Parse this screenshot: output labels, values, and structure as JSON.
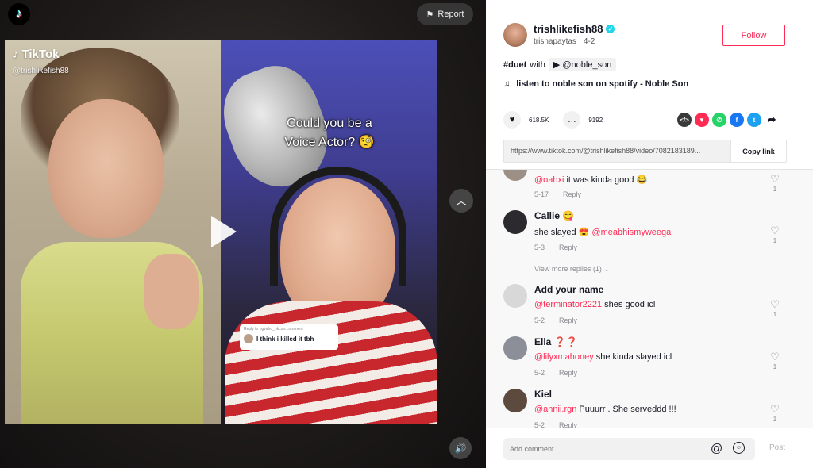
{
  "video": {
    "report_label": "Report",
    "watermark_brand": "TikTok",
    "watermark_user": "@trishlikefish88",
    "caption": "Could you be a Voice Actor? 🧐",
    "reply_title": "Reply to ogvaho_nkcs's comment",
    "reply_text": "I think i killed it tbh",
    "icons": [
      "tiktok-logo-icon",
      "flag-icon",
      "play-icon",
      "chevron-up-icon",
      "volume-icon"
    ]
  },
  "author": {
    "username": "trishlikefish88",
    "nickname": "trishapaytas",
    "date": "4-2",
    "follow_label": "Follow"
  },
  "description": {
    "hashtag": "#duet",
    "with_text": "with",
    "mention": "@noble_son",
    "music": "listen to noble son on spotify - Noble Son"
  },
  "stats": {
    "likes": "618.5K",
    "comments": "9192"
  },
  "share": {
    "url": "https://www.tiktok.com/@trishlikefish88/video/7082183189...",
    "copy_label": "Copy link",
    "icons": [
      "embed-icon",
      "send-icon",
      "whatsapp-icon",
      "facebook-icon",
      "twitter-icon",
      "forward-icon"
    ],
    "colors": {
      "embed": "#3a3a3a",
      "send": "#fe2c55",
      "whatsapp": "#25d366",
      "facebook": "#1877f2",
      "twitter": "#1da1f2"
    }
  },
  "comments": [
    {
      "name": "",
      "mention": "@oahxi",
      "text": "it was kinda good 😂",
      "date": "5-17",
      "reply": "Reply",
      "likes": "1"
    },
    {
      "name": "Callie 😋",
      "mention": "",
      "text": "she slayed 😍",
      "mention_after": "@meabhismyweegal",
      "date": "5-3",
      "reply": "Reply",
      "likes": "1"
    },
    {
      "name": "Add your name",
      "mention": "@terminator2221",
      "text": "shes good icl",
      "date": "5-2",
      "reply": "Reply",
      "likes": "1"
    },
    {
      "name": "Ella ❓❓",
      "mention": "@lilyxmahoney",
      "text": "she kinda slayed icl",
      "date": "5-2",
      "reply": "Reply",
      "likes": "1"
    },
    {
      "name": "Kiel",
      "mention": "@annii.rgn",
      "text": "Puuurr . She serveddd !!!",
      "date": "5-2",
      "reply": "Reply",
      "likes": "1"
    }
  ],
  "view_more": "View more replies (1)",
  "add_comment": {
    "placeholder": "Add comment...",
    "post_label": "Post"
  }
}
